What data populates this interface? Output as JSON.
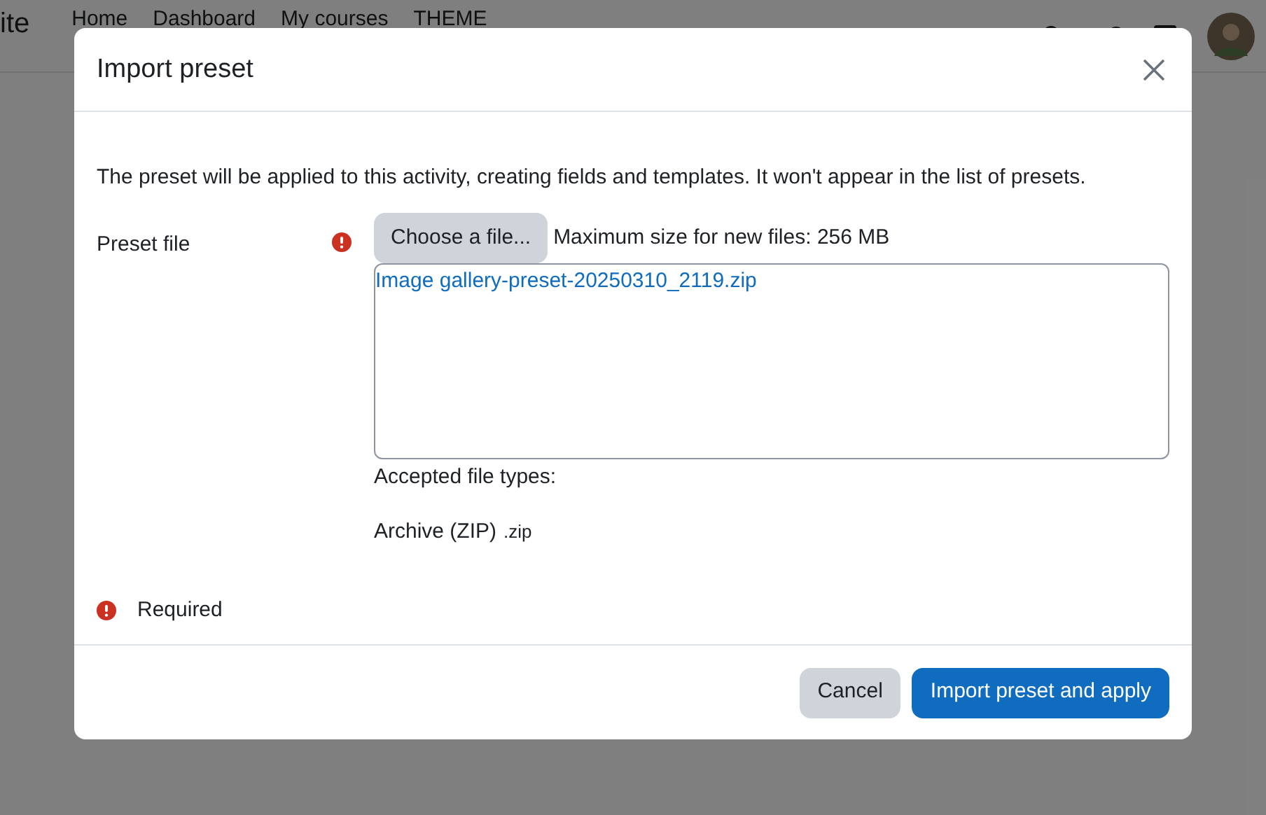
{
  "navbar": {
    "brand": "ite",
    "links": [
      "Home",
      "Dashboard",
      "My courses",
      "THEME"
    ]
  },
  "dialog": {
    "title": "Import preset",
    "description": "The preset will be applied to this activity, creating fields and templates. It won't appear in the list of presets.",
    "field": {
      "label": "Preset file",
      "required": true,
      "choose_button": "Choose a file...",
      "max_size": "Maximum size for new files: 256 MB",
      "files": [
        "Image gallery-preset-20250310_2119.zip"
      ],
      "accepted_label": "Accepted file types:",
      "accepted_types": [
        {
          "name": "Archive (ZIP)",
          "extension": ".zip"
        }
      ]
    },
    "required_note": "Required",
    "buttons": [
      {
        "label": "Cancel",
        "kind": "secondary"
      },
      {
        "label": "Import preset and apply",
        "kind": "primary"
      }
    ]
  }
}
